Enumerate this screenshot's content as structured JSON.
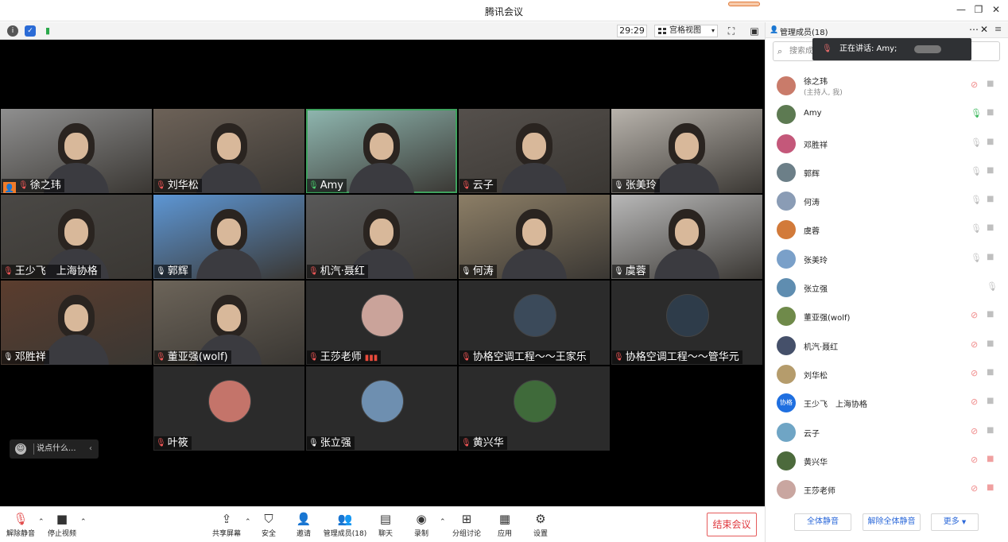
{
  "app": {
    "title": "腾讯会议"
  },
  "toolbar": {
    "timer": "29:29",
    "view_mode": "宫格视图"
  },
  "tiles": [
    {
      "name": "徐之玮",
      "mic": "muted",
      "host": true
    },
    {
      "name": "刘华松",
      "mic": "muted"
    },
    {
      "name": "Amy",
      "mic": "talk",
      "active": true
    },
    {
      "name": "云子",
      "mic": "muted"
    },
    {
      "name": "张美玲",
      "mic": "on"
    },
    {
      "name": "王少飞　上海协格",
      "mic": "muted"
    },
    {
      "name": "郭辉",
      "mic": "on"
    },
    {
      "name": "机汽·聂红",
      "mic": "muted"
    },
    {
      "name": "何涛",
      "mic": "on"
    },
    {
      "name": "虞蓉",
      "mic": "on"
    },
    {
      "name": "邓胜祥",
      "mic": "on"
    },
    {
      "name": "董亚强(wolf)",
      "mic": "muted"
    },
    {
      "name": "王莎老师",
      "mic": "muted",
      "signal": true
    },
    {
      "name": "协格空调工程～～王家乐",
      "mic": "muted"
    },
    {
      "name": "协格空调工程～～管华元",
      "mic": "muted"
    },
    {
      "name": "叶筱",
      "mic": "muted"
    },
    {
      "name": "张立强",
      "mic": "on"
    },
    {
      "name": "黄兴华",
      "mic": "muted"
    }
  ],
  "chat": {
    "placeholder": "说点什么..."
  },
  "bottom": {
    "unmute": "解除静音",
    "stop_video": "停止视频",
    "share": "共享屏幕",
    "security": "安全",
    "invite": "邀请",
    "members": "管理成员(18)",
    "chat": "聊天",
    "record": "录制",
    "breakout": "分组讨论",
    "apps": "应用",
    "settings": "设置",
    "end": "结束会议"
  },
  "panel": {
    "title": "管理成员(18)",
    "search_placeholder": "搜索成",
    "speaking": "正在讲话: Amy;",
    "participants": [
      {
        "name": "徐之玮",
        "sub": "(主持人, 我)",
        "mic": "muted",
        "cam": "on",
        "color": "#c97b6a"
      },
      {
        "name": "Amy",
        "mic": "talk",
        "cam": "on",
        "color": "#5d7a52"
      },
      {
        "name": "邓胜祥",
        "mic": "on",
        "cam": "on",
        "color": "#c4587a"
      },
      {
        "name": "郭辉",
        "mic": "on",
        "cam": "on",
        "color": "#6c7f88"
      },
      {
        "name": "何涛",
        "mic": "on",
        "cam": "on",
        "color": "#8a9cb5"
      },
      {
        "name": "虞蓉",
        "mic": "on",
        "cam": "on",
        "color": "#d27a3a"
      },
      {
        "name": "张美玲",
        "mic": "on",
        "cam": "on",
        "color": "#7aa0c9"
      },
      {
        "name": "张立强",
        "mic": "on",
        "cam": "none",
        "color": "#5f8db0"
      },
      {
        "name": "董亚强(wolf)",
        "mic": "muted",
        "cam": "on",
        "color": "#6f8a4a"
      },
      {
        "name": "机汽·聂红",
        "mic": "muted",
        "cam": "on",
        "color": "#45506a"
      },
      {
        "name": "刘华松",
        "mic": "muted",
        "cam": "on",
        "color": "#b59c6c"
      },
      {
        "name": "王少飞　上海协格",
        "mic": "muted",
        "cam": "on",
        "color": "#1f6fe0",
        "initials": "协格"
      },
      {
        "name": "云子",
        "mic": "muted",
        "cam": "on",
        "color": "#6fa5c5"
      },
      {
        "name": "黄兴华",
        "mic": "muted",
        "cam": "off",
        "color": "#4c6a3c"
      },
      {
        "name": "王莎老师",
        "mic": "muted",
        "cam": "off",
        "color": "#c9a6a0"
      }
    ],
    "mute_all": "全体静音",
    "unmute_all": "解除全体静音",
    "more": "更多"
  }
}
